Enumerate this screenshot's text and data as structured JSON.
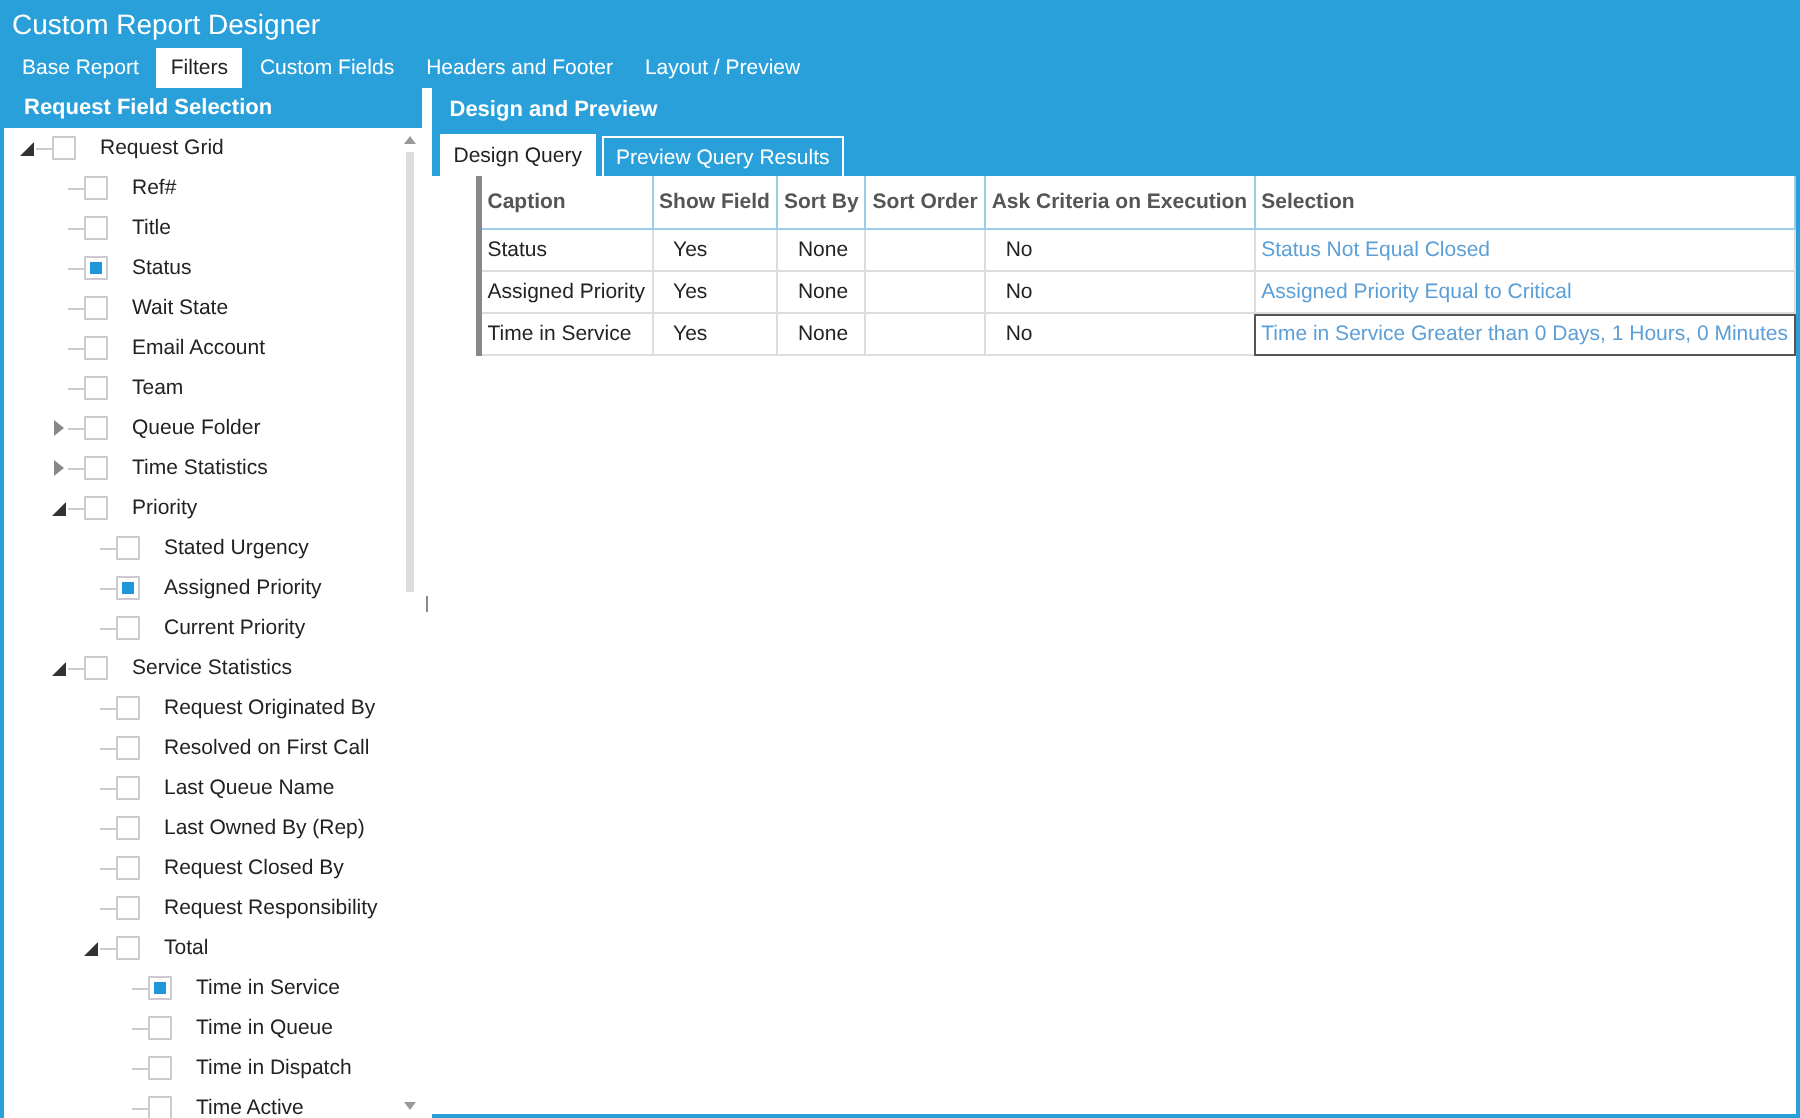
{
  "window": {
    "title": "Custom Report Designer"
  },
  "tabs": [
    {
      "label": "Base Report",
      "selected": false
    },
    {
      "label": "Filters",
      "selected": true
    },
    {
      "label": "Custom Fields",
      "selected": false
    },
    {
      "label": "Headers and Footer",
      "selected": false
    },
    {
      "label": "Layout / Preview",
      "selected": false
    }
  ],
  "left_panel": {
    "title": "Request Field Selection",
    "tree": [
      {
        "label": "Request Grid",
        "checked": false,
        "expanded": true,
        "children": [
          {
            "label": "Ref#",
            "checked": false
          },
          {
            "label": "Title",
            "checked": false
          },
          {
            "label": "Status",
            "checked": true
          },
          {
            "label": "Wait State",
            "checked": false
          },
          {
            "label": "Email Account",
            "checked": false
          },
          {
            "label": "Team",
            "checked": false
          },
          {
            "label": "Queue Folder",
            "checked": false,
            "expanded": false
          },
          {
            "label": "Time Statistics",
            "checked": false,
            "expanded": false
          },
          {
            "label": "Priority",
            "checked": false,
            "expanded": true,
            "children": [
              {
                "label": "Stated Urgency",
                "checked": false
              },
              {
                "label": "Assigned Priority",
                "checked": true
              },
              {
                "label": "Current Priority",
                "checked": false
              }
            ]
          },
          {
            "label": "Service Statistics",
            "checked": false,
            "expanded": true,
            "children": [
              {
                "label": "Request Originated By",
                "checked": false
              },
              {
                "label": "Resolved on First Call",
                "checked": false
              },
              {
                "label": "Last Queue Name",
                "checked": false
              },
              {
                "label": "Last Owned By (Rep)",
                "checked": false
              },
              {
                "label": "Request Closed By",
                "checked": false
              },
              {
                "label": "Request Responsibility",
                "checked": false
              },
              {
                "label": "Total",
                "checked": false,
                "expanded": true,
                "children": [
                  {
                    "label": "Time in Service",
                    "checked": true
                  },
                  {
                    "label": "Time in Queue",
                    "checked": false
                  },
                  {
                    "label": "Time in Dispatch",
                    "checked": false
                  },
                  {
                    "label": "Time Active",
                    "checked": false
                  }
                ]
              }
            ]
          }
        ]
      }
    ]
  },
  "right_panel": {
    "title": "Design and Preview",
    "tabs": [
      {
        "label": "Design Query",
        "selected": true
      },
      {
        "label": "Preview Query Results",
        "selected": false
      }
    ],
    "table": {
      "columns": [
        "Caption",
        "Show Field",
        "Sort By",
        "Sort Order",
        "Ask Criteria on Execution",
        "Selection"
      ],
      "rows": [
        {
          "cells": [
            "Status",
            "Yes",
            "None",
            "",
            "No",
            "Status Not Equal Closed"
          ],
          "selected": false
        },
        {
          "cells": [
            "Assigned Priority",
            "Yes",
            "None",
            "",
            "No",
            "Assigned Priority Equal to Critical"
          ],
          "selected": false
        },
        {
          "cells": [
            "Time in Service",
            "Yes",
            "None",
            "",
            "No",
            "Time in Service Greater than 0 Days, 1 Hours, 0 Minutes"
          ],
          "selected": true
        }
      ]
    }
  }
}
